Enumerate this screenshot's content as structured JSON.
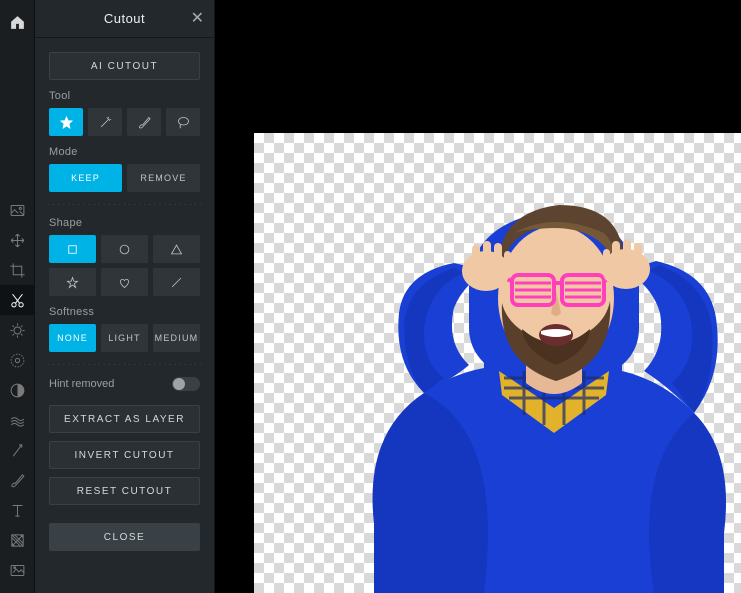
{
  "panel": {
    "title": "Cutout",
    "ai_cutout_label": "AI CUTOUT",
    "tool_label": "Tool",
    "mode_label": "Mode",
    "mode_keep": "KEEP",
    "mode_remove": "REMOVE",
    "shape_label": "Shape",
    "softness_label": "Softness",
    "softness_none": "NONE",
    "softness_light": "LIGHT",
    "softness_medium": "MEDIUM",
    "hint_removed_label": "Hint removed",
    "extract_label": "EXTRACT AS LAYER",
    "invert_label": "INVERT CUTOUT",
    "reset_label": "RESET CUTOUT",
    "close_label": "CLOSE"
  },
  "tools": {
    "items": [
      "magic-tool",
      "wand-tool",
      "draw-tool",
      "lasso-tool"
    ],
    "active_index": 0
  },
  "shapes": {
    "items": [
      "square",
      "circle",
      "triangle",
      "star",
      "heart",
      "line"
    ],
    "active_index": 0
  },
  "mode_active_index": 0,
  "softness_active_index": 0,
  "hint_removed_on": false,
  "colors": {
    "accent": "#00b3e6",
    "panel_bg": "#23282c",
    "strip_bg": "#1a1e21"
  },
  "left_tools": [
    "image-tool",
    "move-tool",
    "crop-tool",
    "cutout-tool",
    "adjust-tool",
    "filter-tool",
    "liquify-tool",
    "retouch-tool",
    "clone-tool",
    "draw-tool",
    "text-tool",
    "fill-tool",
    "frame-tool"
  ],
  "left_tools_active_index": 3,
  "canvas": {
    "subject_description": "Bearded man in blue sweater with yellow plaid collar holding pink shutter sunglasses, transparent background"
  }
}
